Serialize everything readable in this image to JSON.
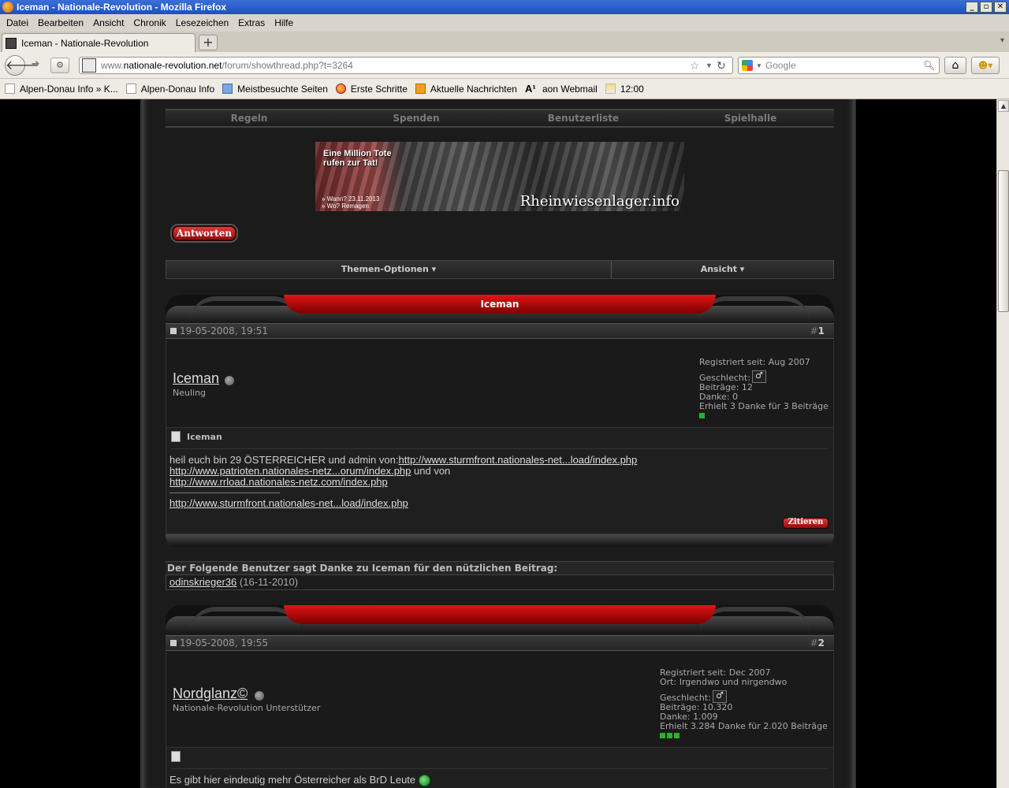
{
  "window": {
    "title": "Iceman - Nationale-Revolution - Mozilla Firefox",
    "buttons": [
      "_",
      "▫",
      "✕"
    ]
  },
  "menu": [
    "Datei",
    "Bearbeiten",
    "Ansicht",
    "Chronik",
    "Lesezeichen",
    "Extras",
    "Hilfe"
  ],
  "tab": {
    "label": "Iceman - Nationale-Revolution",
    "close": "✕",
    "new": "+"
  },
  "urlbar": {
    "prefix": "www.",
    "domain": "nationale-revolution.net",
    "path": "/forum/showthread.php?t=3264"
  },
  "search": {
    "placeholder": "Google"
  },
  "bookmarks": [
    "Alpen-Donau Info » K...",
    "Alpen-Donau Info",
    "Meistbesuchte Seiten",
    "Erste Schritte",
    "Aktuelle Nachrichten",
    "aon Webmail",
    "12:00"
  ],
  "forum": {
    "nav": [
      "Regeln",
      "Spenden",
      "Benutzerliste",
      "Spielhalle"
    ],
    "banner": {
      "headline": "Eine Million Tote rufen zur Tat!",
      "when": "» Wann?  23.11.2013",
      "where": "» Wo?     Remagen",
      "brand": "Rheinwiesenlager.info"
    },
    "reply_button": "Antworten",
    "thread_options": "Themen-Optionen ▾",
    "view_options": "Ansicht ▾",
    "posts": [
      {
        "header_title": "Iceman",
        "date": "19-05-2008, 19:51",
        "number_prefix": "#",
        "number": "1",
        "username": "Iceman",
        "user_title": "Neuling",
        "registered": "Registriert seit: Aug 2007",
        "location": "",
        "gender_label": "Geschlecht:",
        "gender_symbol": "♂",
        "posts_count": "Beiträge: 12",
        "thanks_given": "Danke: 0",
        "thanks_received": "Erhielt 3 Danke für 3 Beiträge",
        "message_title": "Iceman",
        "body_line1_text": "heil euch bin 29 ÖSTERREICHER und admin von:",
        "body_line1_link": "http://www.sturmfront.nationales-net...load/index.php",
        "body_line2_link": "http://www.patrioten.nationales-netz...orum/index.php",
        "body_line2_text": " und von",
        "body_line3_link": "http://www.rrload.nationales-netz.com/index.php",
        "body_sig_link": "http://www.sturmfront.nationales-net...load/index.php",
        "quote_button": "Zitieren"
      },
      {
        "header_title": "",
        "date": "19-05-2008, 19:55",
        "number_prefix": "#",
        "number": "2",
        "username": "Nordglanz©",
        "user_title": "Nationale-Revolution Unterstützer",
        "registered": "Registriert seit: Dec 2007",
        "location": "Ort: Irgendwo und nirgendwo",
        "gender_label": "Geschlecht:",
        "gender_symbol": "♂",
        "posts_count": "Beiträge: 10.320",
        "thanks_given": "Danke: 1.009",
        "thanks_received": "Erhielt 3.284 Danke für 2.020 Beiträge",
        "body_line1_text": "Es gibt hier eindeutig mehr Österreicher als BrD Leute"
      }
    ],
    "thanks": {
      "heading": "Der Folgende Benutzer sagt Danke zu Iceman für den nützlichen Beitrag:",
      "user": "odinskrieger36",
      "date": "(16-11-2010)"
    }
  }
}
